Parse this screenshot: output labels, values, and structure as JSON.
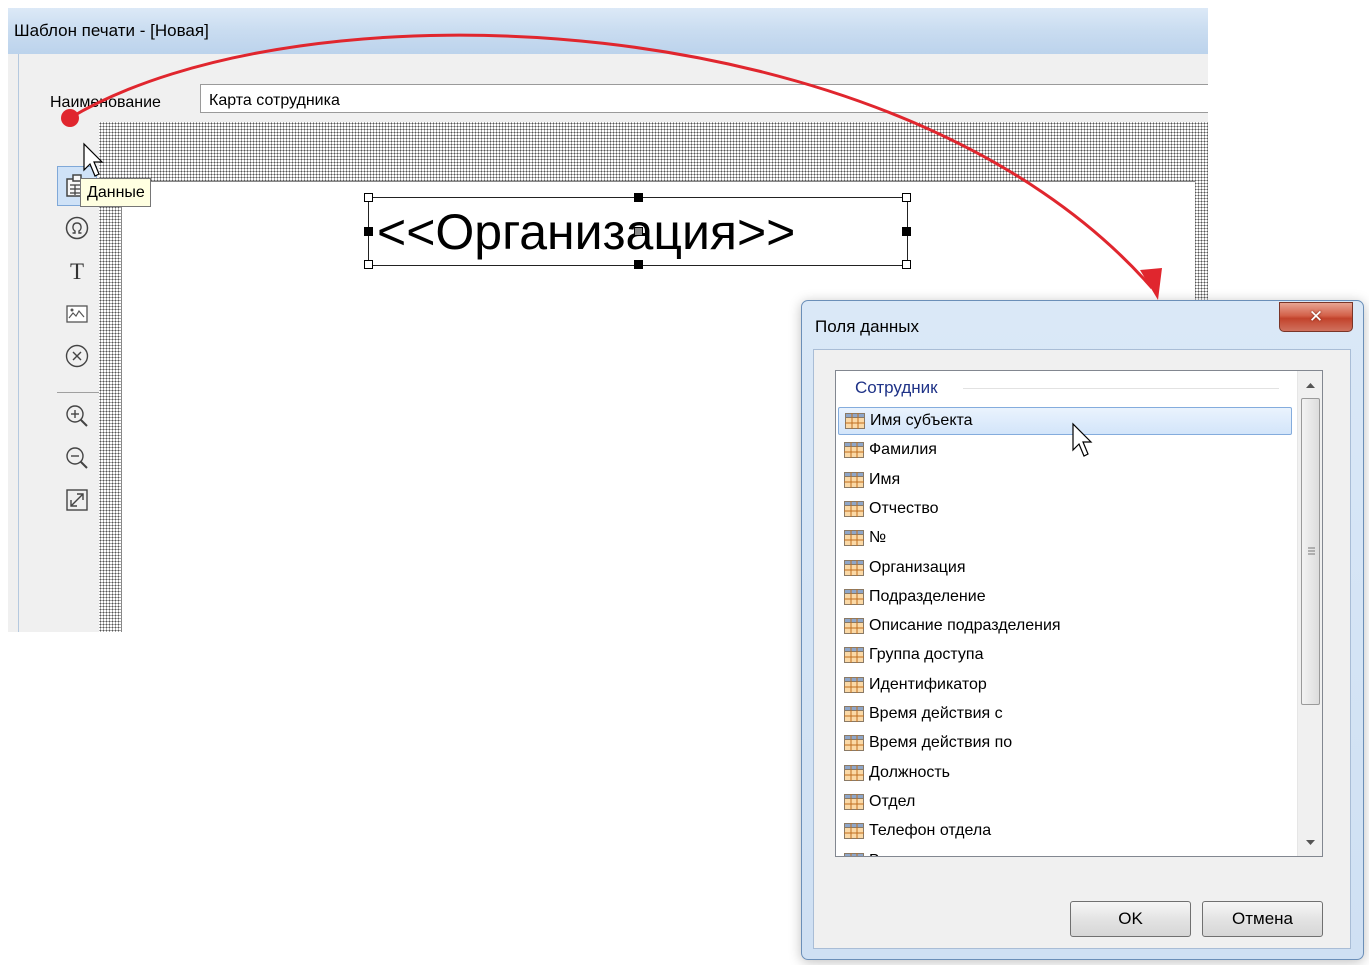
{
  "main_window": {
    "title": "Шаблон печати -  [Новая]",
    "name_label": "Наименование",
    "name_value": "Карта сотрудника",
    "tooltip": "Данные",
    "field_text": "<<Организация>>",
    "toolbar": [
      {
        "name": "data-icon",
        "active": true
      },
      {
        "name": "omega-icon"
      },
      {
        "name": "text-icon",
        "glyph": "T"
      },
      {
        "name": "image-icon"
      },
      {
        "name": "delete-icon"
      },
      {
        "name": "zoom-in-icon"
      },
      {
        "name": "zoom-out-icon"
      },
      {
        "name": "fit-icon"
      }
    ]
  },
  "dialog": {
    "title": "Поля данных",
    "close_glyph": "✕",
    "group": "Сотрудник",
    "items": [
      "Имя субъекта",
      "Фамилия",
      "Имя",
      "Отчество",
      "№",
      "Организация",
      "Подразделение",
      "Описание подразделения",
      "Группа доступа",
      "Идентификатор",
      "Время действия с",
      "Время действия по",
      "Должность",
      "Отдел",
      "Телефон отдела",
      "В"
    ],
    "selected_index": 0,
    "ok_label": "OK",
    "cancel_label": "Отмена"
  },
  "colors": {
    "annotation_arrow": "#e0262e",
    "selection": "#d3e5fa",
    "group_header": "#1e3287",
    "field_icon": "#f0a030"
  }
}
